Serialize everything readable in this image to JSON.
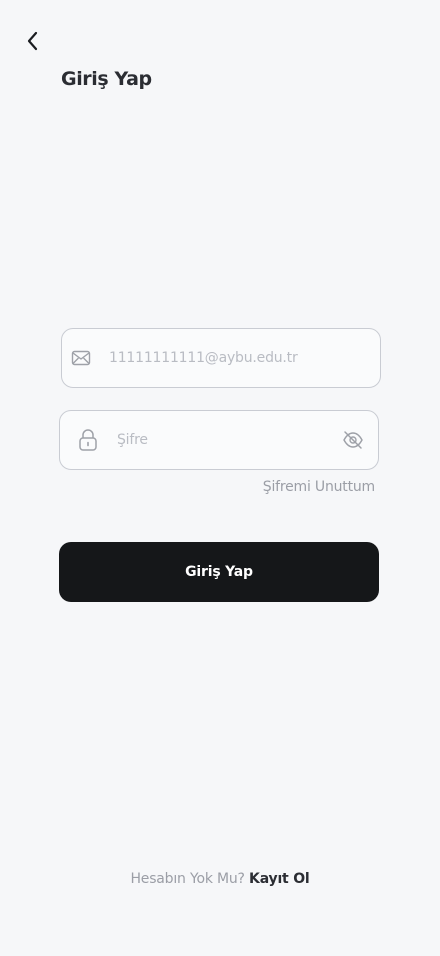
{
  "header": {
    "title": "Giriş Yap",
    "back_icon": "chevron-left-icon"
  },
  "form": {
    "email": {
      "placeholder": "11111111111@aybu.edu.tr",
      "value": "",
      "icon": "mail-icon"
    },
    "password": {
      "placeholder": "Şifre",
      "value": "",
      "icon": "lock-icon",
      "toggle_icon": "eye-off-icon"
    },
    "forgot_label": "Şifremi Unuttum",
    "submit_label": "Giriş Yap"
  },
  "footer": {
    "prompt": "Hesabın Yok Mu?",
    "link_label": "Kayıt Ol"
  },
  "colors": {
    "background": "#f6f7f9",
    "primary_button": "#151719",
    "border": "#c9ccd3",
    "muted_text": "#9b9ea6",
    "title_text": "#2b2d33"
  }
}
